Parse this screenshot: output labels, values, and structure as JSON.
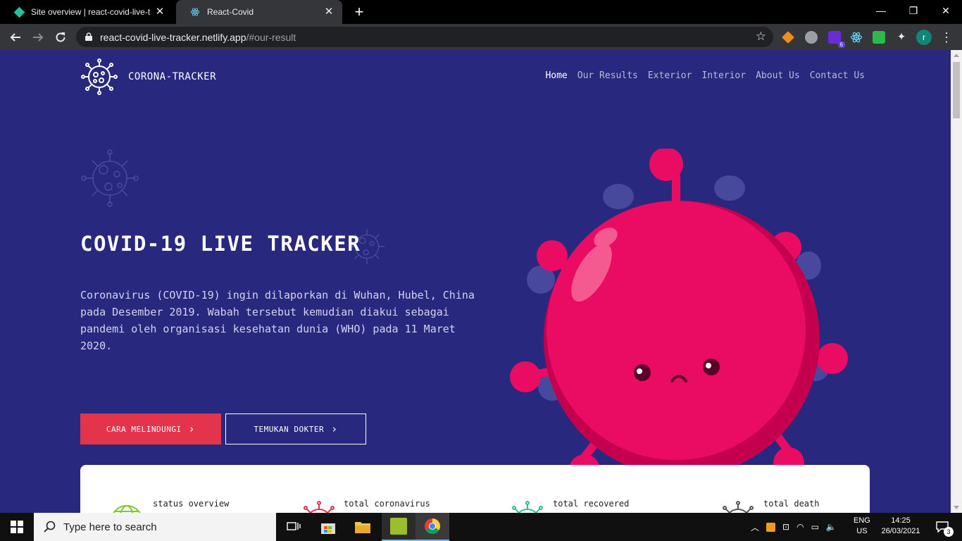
{
  "browser": {
    "tabs": [
      {
        "title": "Site overview | react-covid-live-tr",
        "active": false
      },
      {
        "title": "React-Covid",
        "active": true
      }
    ],
    "url_host": "react-covid-live-tracker.netlify.app",
    "url_path": "/#our-result",
    "extension_badge": "6",
    "profile_initial": "r"
  },
  "site": {
    "brand": "CORONA-TRACKER",
    "nav": [
      "Home",
      "Our Results",
      "Exterior",
      "Interior",
      "About Us",
      "Contact Us"
    ],
    "hero_title": "COVID-19 LIVE TRACKER",
    "hero_text": "Coronavirus (COVID-19) ingin dilaporkan di Wuhan, Hubel, China pada Desember 2019. Wabah tersebut kemudian diakui sebagai pandemi oleh organisasi kesehatan dunia (WHO) pada 11 Maret 2020.",
    "btn_primary": "CARA MELINDUNGI",
    "btn_secondary": "TEMUKAN DOKTER",
    "stats": [
      "status overview",
      "total coronavirus",
      "total recovered",
      "total death"
    ]
  },
  "colors": {
    "page_bg": "#28287e",
    "accent_red": "#e3344c",
    "virus_pink": "#ea0b62"
  },
  "taskbar": {
    "search_placeholder": "Type here to search",
    "lang_line1": "ENG",
    "lang_line2": "US",
    "time": "14:25",
    "date": "26/03/2021",
    "notifications": "3"
  }
}
